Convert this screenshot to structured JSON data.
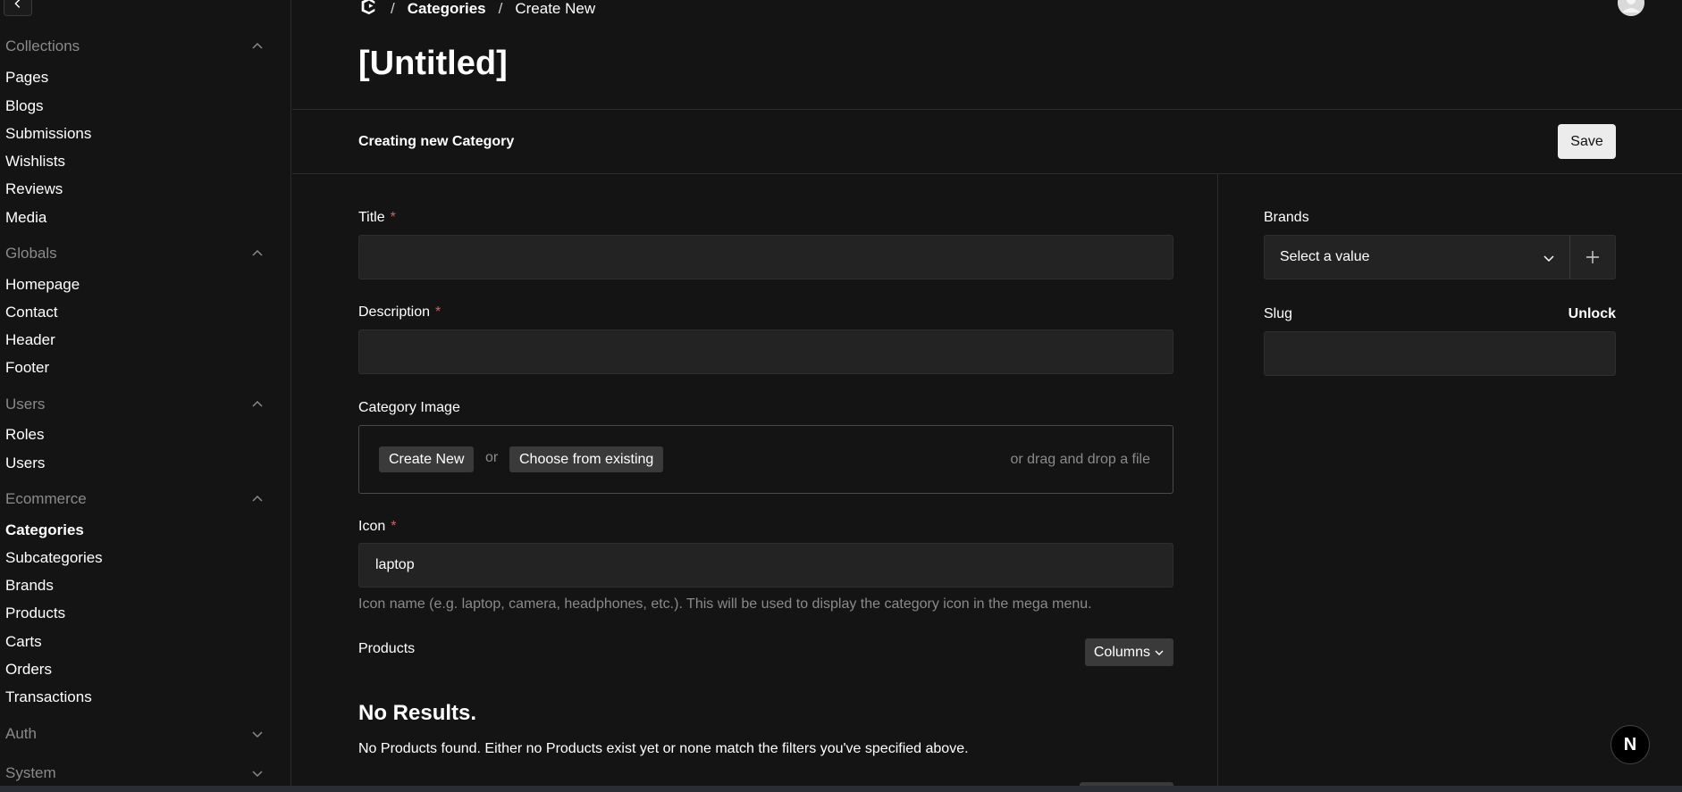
{
  "sidebar": {
    "groups": [
      {
        "title": "Collections",
        "items": [
          "Pages",
          "Blogs",
          "Submissions",
          "Wishlists",
          "Reviews",
          "Media"
        ]
      },
      {
        "title": "Globals",
        "items": [
          "Homepage",
          "Contact",
          "Header",
          "Footer"
        ]
      },
      {
        "title": "Users",
        "items": [
          "Roles",
          "Users"
        ]
      },
      {
        "title": "Ecommerce",
        "items": [
          "Categories",
          "Subcategories",
          "Brands",
          "Products",
          "Carts",
          "Orders",
          "Transactions"
        ]
      },
      {
        "title": "Auth",
        "items": []
      },
      {
        "title": "System",
        "items": []
      }
    ],
    "active_item": "Categories"
  },
  "breadcrumb": {
    "items": [
      "Categories",
      "Create New"
    ]
  },
  "page_title": "[Untitled]",
  "toolbar": {
    "status": "Creating new Category",
    "save_label": "Save"
  },
  "form": {
    "title": {
      "label": "Title",
      "required": "*",
      "value": ""
    },
    "description": {
      "label": "Description",
      "required": "*",
      "value": ""
    },
    "category_image": {
      "label": "Category Image",
      "create_new": "Create New",
      "or": "or",
      "choose_existing": "Choose from existing",
      "drag_drop": "or drag and drop a file"
    },
    "icon": {
      "label": "Icon",
      "required": "*",
      "value": "laptop",
      "helper": "Icon name (e.g. laptop, camera, headphones, etc.). This will be used to display the category icon in the mega menu."
    },
    "products": {
      "label": "Products",
      "columns_label": "Columns",
      "no_results_title": "No Results.",
      "no_results_text": "No Products found. Either no Products exist yet or none match the filters you've specified above."
    }
  },
  "side_fields": {
    "brands": {
      "label": "Brands",
      "placeholder": "Select a value"
    },
    "slug": {
      "label": "Slug",
      "unlock": "Unlock",
      "value": ""
    }
  },
  "badge": {
    "letter": "N"
  }
}
